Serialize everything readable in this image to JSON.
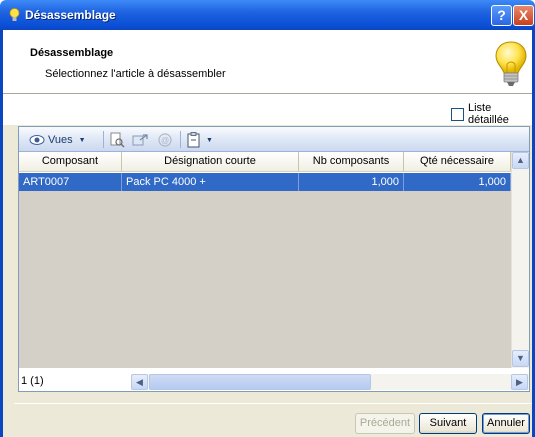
{
  "window": {
    "title": "Désassemblage",
    "help_glyph": "?",
    "close_glyph": "X"
  },
  "header": {
    "title": "Désassemblage",
    "subtitle": "Sélectionnez l'article à désassembler"
  },
  "options": {
    "detailed_list_label": "Liste détaillée",
    "detailed_list_checked": false
  },
  "toolbar": {
    "views_label": "Vues"
  },
  "grid": {
    "columns": [
      "Composant",
      "Désignation courte",
      "Nb composants",
      "Qté nécessaire"
    ],
    "rows": [
      {
        "composant": "ART0007",
        "designation": "Pack PC 4000 +",
        "nb": "1,000",
        "qte": "1,000"
      }
    ],
    "record_count": "1 (1)"
  },
  "buttons": {
    "previous": "Précédent",
    "next": "Suivant",
    "cancel": "Annuler"
  },
  "colors": {
    "title_bar": "#0a4fd6",
    "selection": "#3169c6",
    "empty_grid": "#d4d0c8"
  }
}
